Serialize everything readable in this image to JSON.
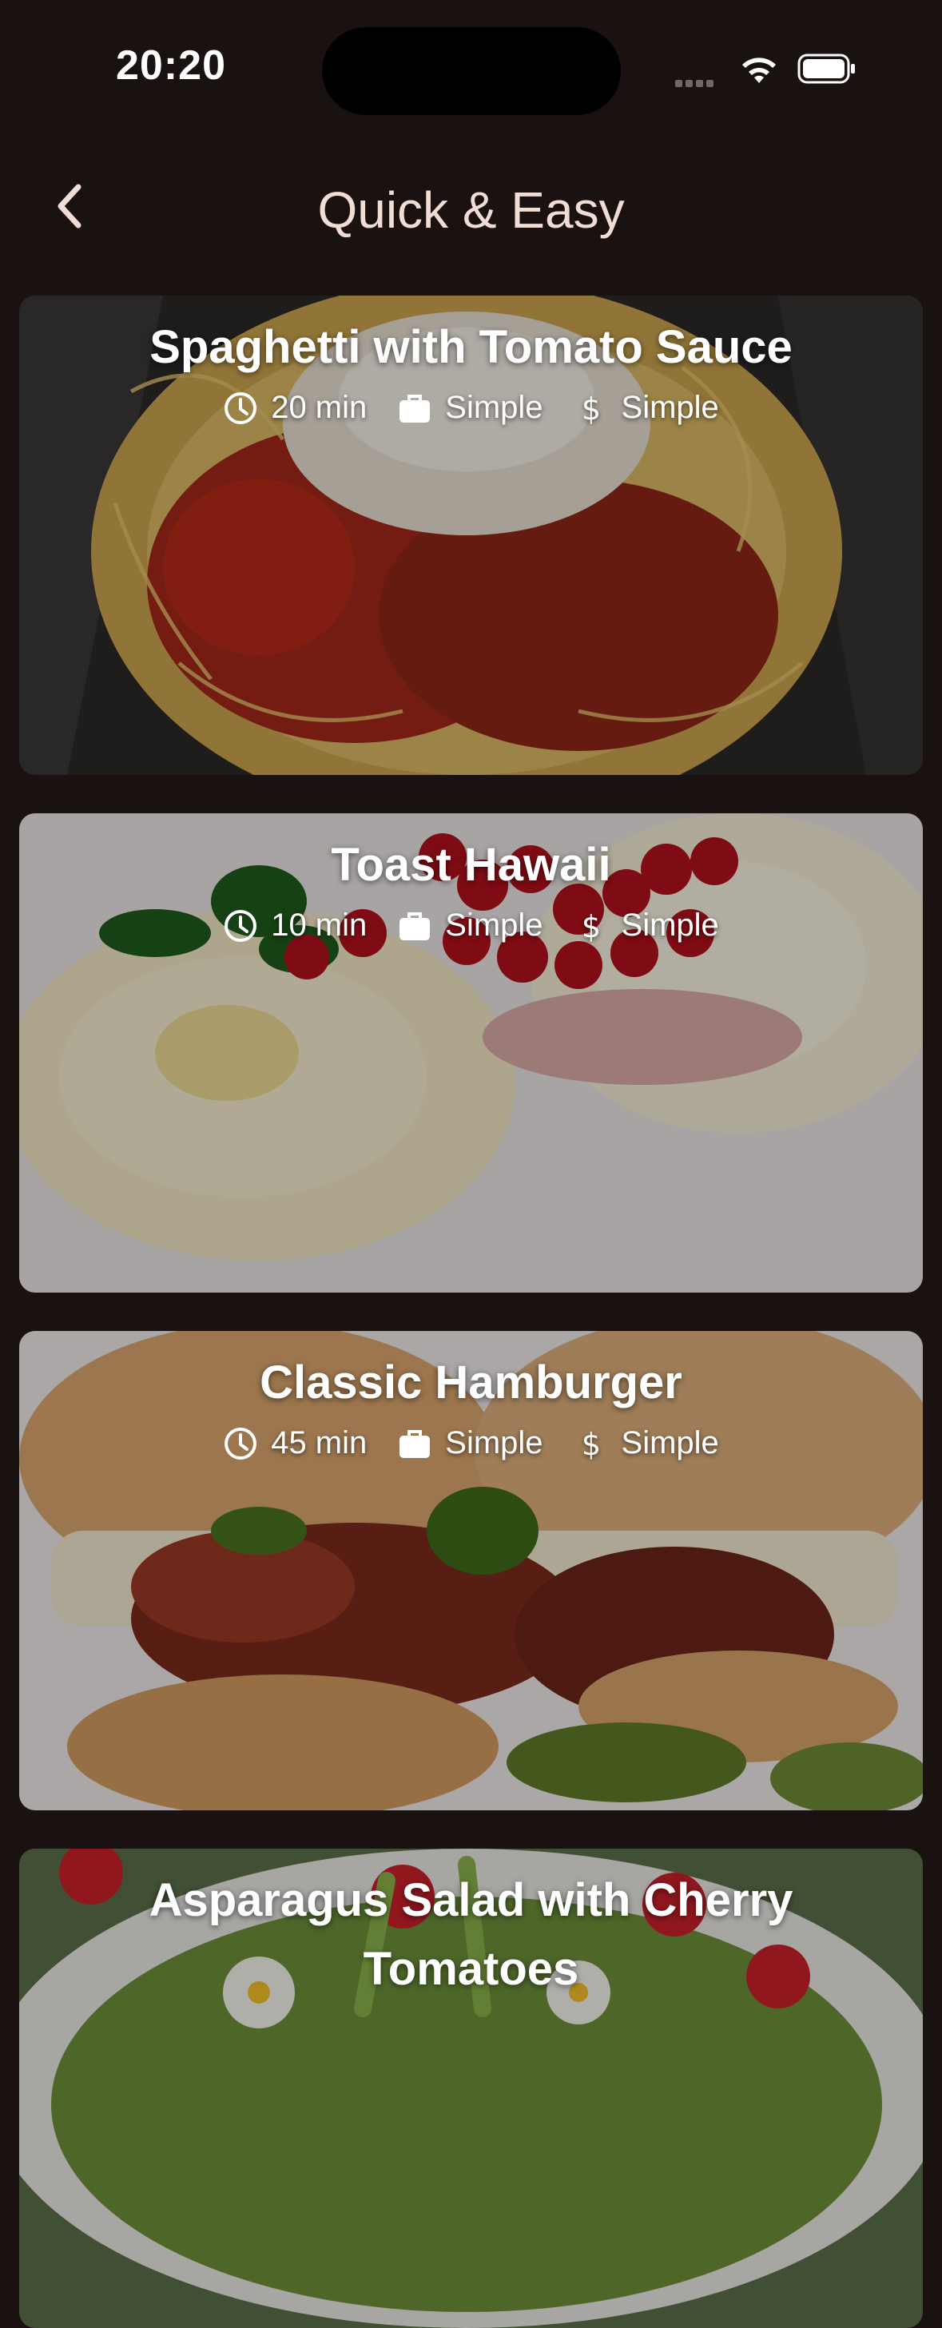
{
  "status_bar": {
    "time": "20:20"
  },
  "app_bar": {
    "title": "Quick & Easy"
  },
  "meals": [
    {
      "title": "Spaghetti with Tomato Sauce",
      "duration": "20 min",
      "complexity": "Simple",
      "affordability": "Simple"
    },
    {
      "title": "Toast Hawaii",
      "duration": "10 min",
      "complexity": "Simple",
      "affordability": "Simple"
    },
    {
      "title": "Classic Hamburger",
      "duration": "45 min",
      "complexity": "Simple",
      "affordability": "Simple"
    },
    {
      "title": "Asparagus Salad with Cherry Tomatoes",
      "duration": "",
      "complexity": "",
      "affordability": ""
    }
  ],
  "colors": {
    "background": "#1a1210",
    "title": "#f1dcd6"
  },
  "icons": {
    "back": "chevron-left-icon",
    "duration": "clock-icon",
    "complexity": "briefcase-icon",
    "affordability": "dollar-icon"
  }
}
